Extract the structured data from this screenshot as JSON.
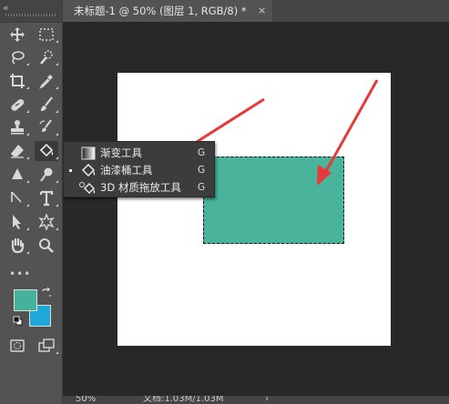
{
  "document_tab": {
    "title": "未标题-1 @ 50% (图层 1, RGB/8) *",
    "close_glyph": "×"
  },
  "toolbar": {
    "collapse_glyph": "«",
    "more_glyph": "•••",
    "tools": [
      {
        "name": "move-tool",
        "icon": "move-icon"
      },
      {
        "name": "marquee-tool",
        "icon": "marquee-icon"
      },
      {
        "name": "lasso-tool",
        "icon": "lasso-icon"
      },
      {
        "name": "quick-selection-tool",
        "icon": "quick-selection-icon"
      },
      {
        "name": "crop-tool",
        "icon": "crop-icon"
      },
      {
        "name": "eyedropper-tool",
        "icon": "eyedropper-icon"
      },
      {
        "name": "healing-brush-tool",
        "icon": "bandage-icon"
      },
      {
        "name": "brush-tool",
        "icon": "brush-icon"
      },
      {
        "name": "clone-stamp-tool",
        "icon": "stamp-icon"
      },
      {
        "name": "history-brush-tool",
        "icon": "history-brush-icon"
      },
      {
        "name": "eraser-tool",
        "icon": "eraser-icon"
      },
      {
        "name": "paint-bucket-tool",
        "icon": "paint-bucket-icon"
      },
      {
        "name": "blur-tool",
        "icon": "blur-drop-icon"
      },
      {
        "name": "dodge-tool",
        "icon": "dodge-icon"
      },
      {
        "name": "pen-tool",
        "icon": "pen-icon"
      },
      {
        "name": "type-tool",
        "icon": "type-icon"
      },
      {
        "name": "path-selection-tool",
        "icon": "path-selection-icon"
      },
      {
        "name": "custom-shape-tool",
        "icon": "shape-icon"
      },
      {
        "name": "hand-tool",
        "icon": "hand-icon"
      },
      {
        "name": "zoom-tool",
        "icon": "zoom-icon"
      }
    ],
    "foreground_color": "#45b39c",
    "background_color": "#1fa7d8"
  },
  "flyout_menu": {
    "items": [
      {
        "label": "渐变工具",
        "shortcut": "G",
        "selected": false,
        "icon": "gradient-icon"
      },
      {
        "label": "油漆桶工具",
        "shortcut": "G",
        "selected": true,
        "icon": "paint-bucket-icon"
      },
      {
        "label": "3D 材质拖放工具",
        "shortcut": "G",
        "selected": false,
        "icon": "3d-material-drop-icon"
      }
    ]
  },
  "canvas": {
    "page_color": "#ffffff",
    "selection_fill": "#49b49b",
    "annotation_color": "#e8393a"
  },
  "status_bar": {
    "zoom": "50%",
    "doc_info": "文档:1.03M/1.03M",
    "arrow_glyph": "›"
  }
}
